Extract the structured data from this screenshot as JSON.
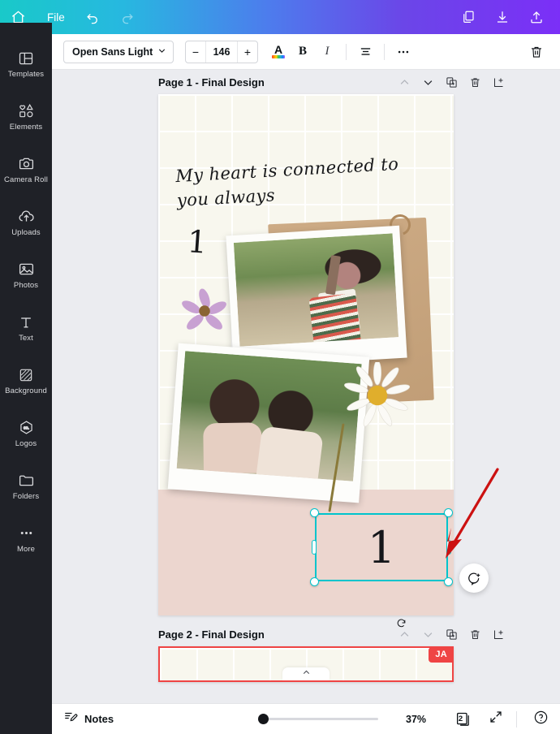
{
  "header": {
    "file_menu": "File",
    "icons": {
      "home": "home-icon",
      "undo": "undo-icon",
      "redo": "redo-icon",
      "duplicate": "duplicate-icon",
      "download": "download-icon",
      "share": "share-icon"
    },
    "gradient_from": "#19c9c9",
    "gradient_to": "#7b2ff7"
  },
  "sidebar": {
    "items": [
      {
        "label": "Templates",
        "icon": "templates-icon"
      },
      {
        "label": "Elements",
        "icon": "elements-icon"
      },
      {
        "label": "Camera Roll",
        "icon": "camera-roll-icon"
      },
      {
        "label": "Uploads",
        "icon": "uploads-icon"
      },
      {
        "label": "Photos",
        "icon": "photos-icon"
      },
      {
        "label": "Text",
        "icon": "text-icon"
      },
      {
        "label": "Background",
        "icon": "background-icon"
      },
      {
        "label": "Logos",
        "icon": "logos-icon"
      },
      {
        "label": "Folders",
        "icon": "folders-icon"
      },
      {
        "label": "More",
        "icon": "more-icon"
      }
    ]
  },
  "toolbar": {
    "font_family": "Open Sans Light",
    "font_size": "146",
    "decrease_label": "−",
    "increase_label": "+",
    "bold_label": "B",
    "italic_label": "I",
    "text_color_label": "A",
    "icons": {
      "chevron": "chevron-down-icon",
      "align": "align-icon",
      "more": "more-horizontal-icon",
      "delete": "trash-icon"
    }
  },
  "pages": [
    {
      "title": "Page 1 - Final Design",
      "actions": [
        "move-up-icon",
        "move-down-icon",
        "duplicate-page-icon",
        "delete-page-icon",
        "add-page-icon"
      ]
    },
    {
      "title": "Page 2 - Final Design",
      "actions": [
        "move-up-icon",
        "move-down-icon",
        "duplicate-page-icon",
        "delete-page-icon",
        "add-page-icon"
      ],
      "collaborator_badge": "JA",
      "collaborator_color": "#ef4444"
    }
  ],
  "canvas": {
    "script_text": "My heart is connected to you always",
    "decor_number": "1",
    "selected_element_text": "1",
    "selection_color": "#00c4cc",
    "comment_icon": "add-comment-icon",
    "annotation_arrow_color": "#cc1111"
  },
  "bottombar": {
    "notes_label": "Notes",
    "notes_icon": "notes-icon",
    "zoom_percent": "37%",
    "page_count": "2",
    "pages_icon": "pages-icon",
    "expand_icon": "expand-icon",
    "help_icon": "help-icon"
  }
}
